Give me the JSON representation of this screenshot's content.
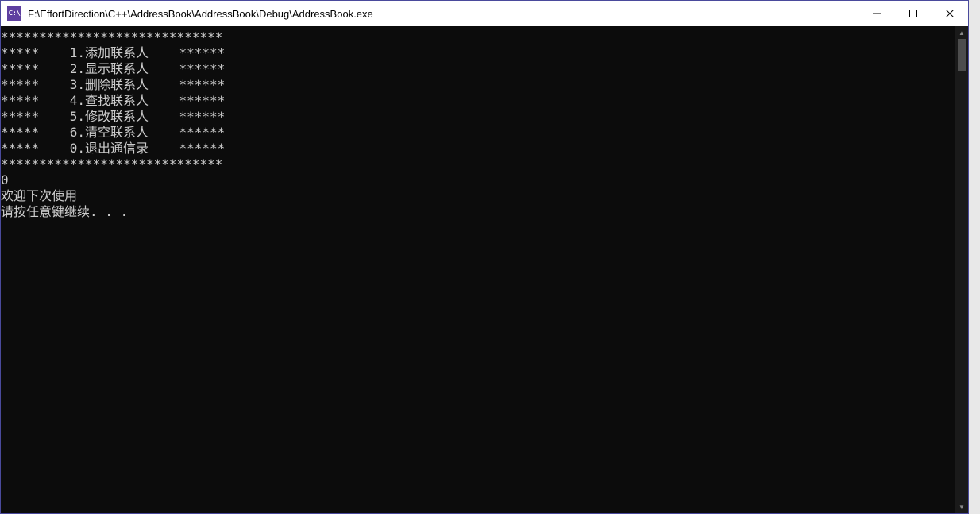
{
  "window": {
    "icon_label": "C:\\",
    "title": "F:\\EffortDirection\\C++\\AddressBook\\AddressBook\\Debug\\AddressBook.exe"
  },
  "console": {
    "border_top": "*****************************",
    "menu": [
      "*****    1.添加联系人    ******",
      "*****    2.显示联系人    ******",
      "*****    3.删除联系人    ******",
      "*****    4.查找联系人    ******",
      "*****    5.修改联系人    ******",
      "*****    6.清空联系人    ******",
      "*****    0.退出通信录    ******"
    ],
    "border_bottom": "*****************************",
    "user_input": "0",
    "goodbye": "欢迎下次使用",
    "press_any_key": "请按任意键继续. . ."
  }
}
